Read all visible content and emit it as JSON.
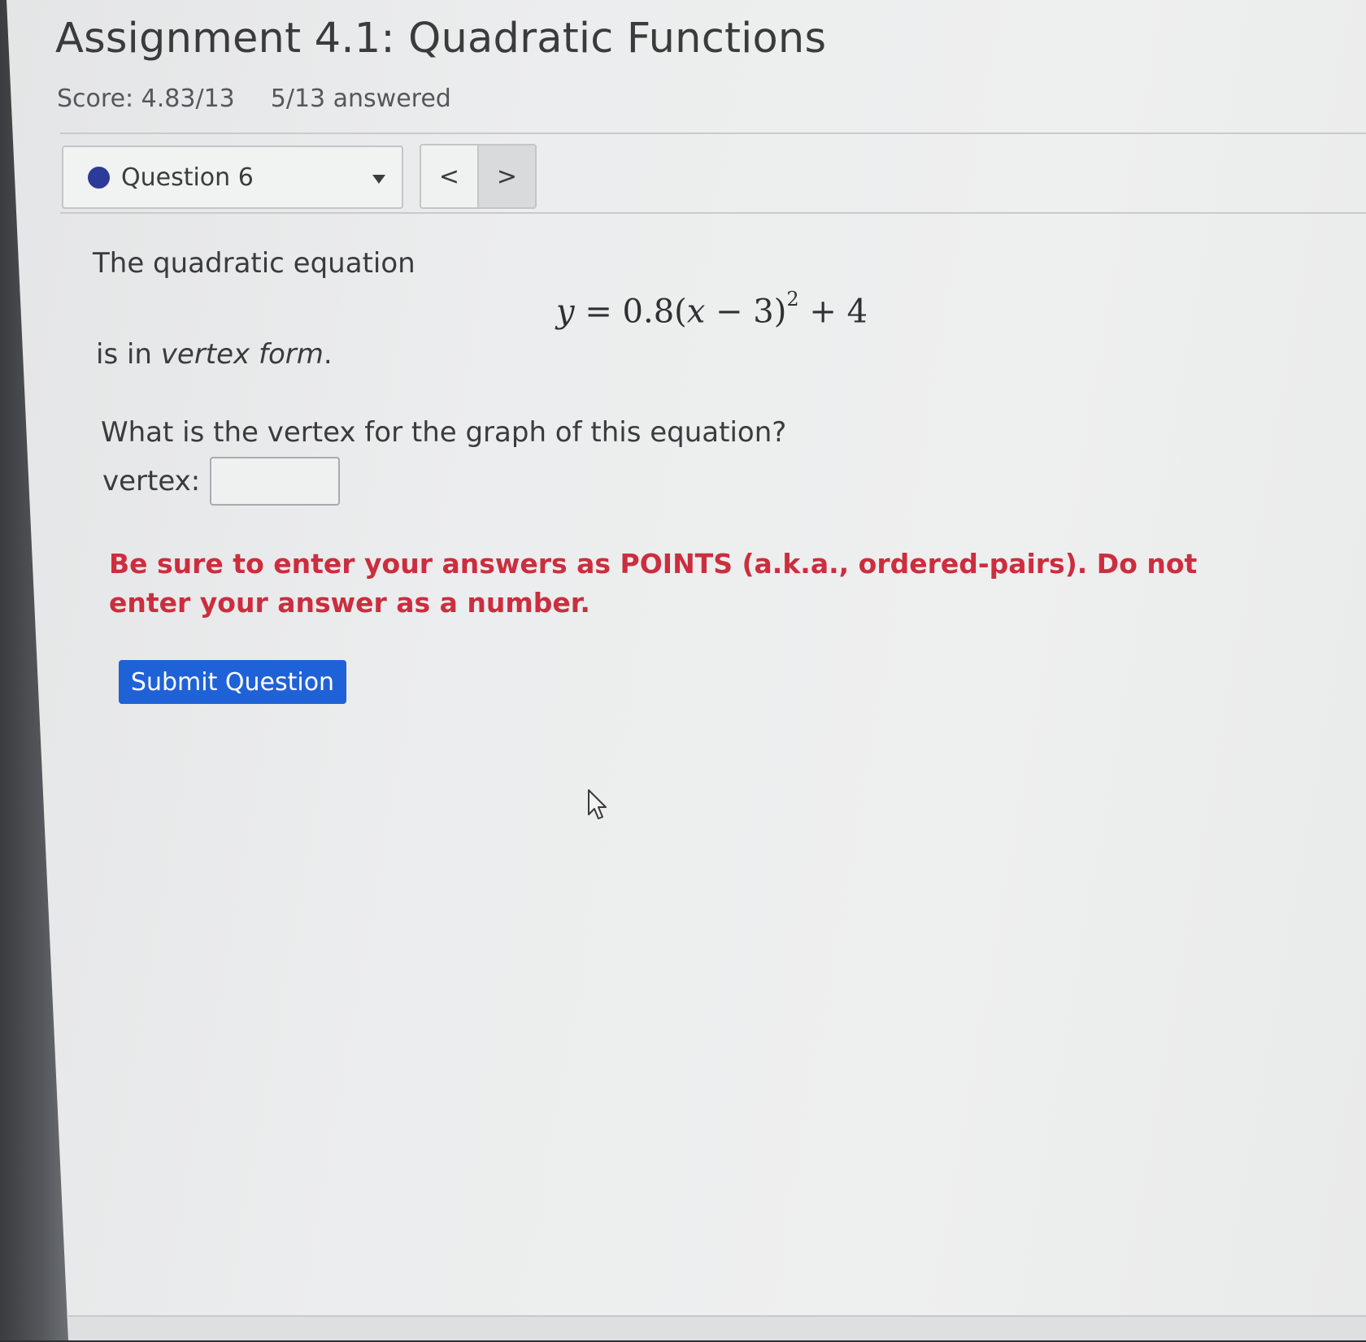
{
  "assignment": {
    "title": "Assignment 4.1: Quadratic Functions",
    "score": "Score: 4.83/13",
    "answered": "5/13 answered"
  },
  "question_nav": {
    "current_question": "Question 6",
    "prev_symbol": "<",
    "next_symbol": ">",
    "status_color": "#2c3a9a"
  },
  "question": {
    "intro": "The quadratic equation",
    "equation": {
      "y": "y",
      "equals": " = 0.8(",
      "x": "x",
      "minus": " − 3)",
      "exponent": "2",
      "plus": " + 4"
    },
    "is_in": "is in ",
    "form_name": "vertex form",
    "form_end": ".",
    "prompt": "What is the vertex for the graph of this equation?",
    "vertex_label": "vertex:",
    "vertex_value": "",
    "warning": "Be sure to enter your answers as POINTS (a.k.a., ordered-pairs). Do not enter your answer as a number.",
    "warning_color": "#cb2e3e"
  },
  "actions": {
    "submit_label": "Submit Question",
    "accent": "#1f62d8"
  }
}
